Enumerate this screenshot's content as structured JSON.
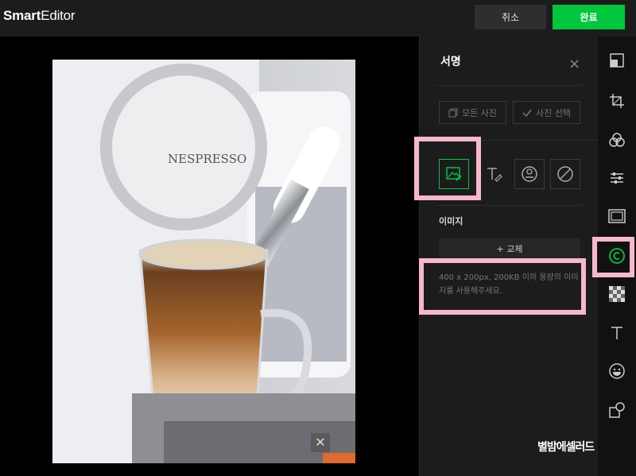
{
  "app": {
    "logo_bold": "Smart",
    "logo_rest": "Editor"
  },
  "header": {
    "cancel_label": "취소",
    "done_label": "완료"
  },
  "photo": {
    "brand": "NESPRESSO"
  },
  "panel": {
    "title": "서명",
    "scope_all": "모든 사진",
    "scope_select": "사진 선택",
    "section_label": "이미지",
    "replace_label": "+ 교체",
    "hint": "400 x 200px, 200KB 이하 용량의 이미지를 사용해주세요."
  },
  "tools": [
    "image-signature-icon",
    "text-signature-icon",
    "stamp-signature-icon",
    "no-signature-icon"
  ],
  "sidebar": [
    "layout-icon",
    "crop-icon",
    "filter-icon",
    "adjust-icon",
    "frame-icon",
    "signature-icon",
    "mosaic-icon",
    "text-icon",
    "sticker-icon",
    "shapes-icon"
  ],
  "watermark": "별밤에셀러드",
  "colors": {
    "accent": "#00c73c",
    "highlight": "#f7b8cc",
    "panel_bg": "#1c1c1c"
  }
}
